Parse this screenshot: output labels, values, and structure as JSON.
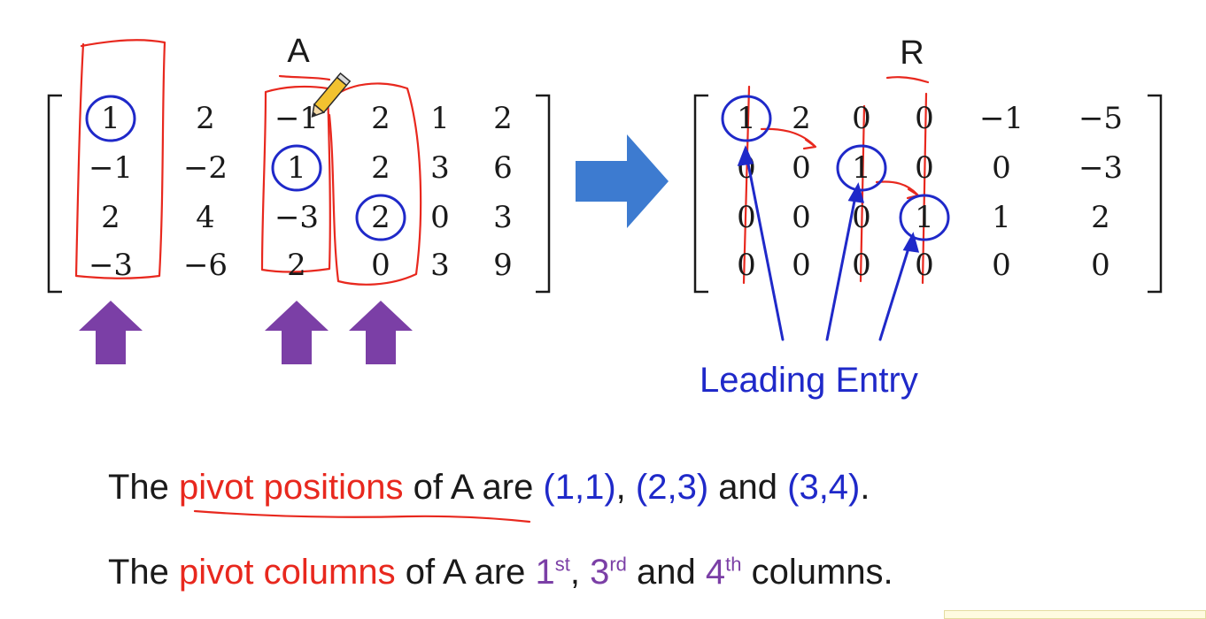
{
  "matrix_a": {
    "label": "A",
    "rows": [
      [
        "1",
        "2",
        "−1",
        "2",
        "1",
        "2"
      ],
      [
        "−1",
        "−2",
        "1",
        "2",
        "3",
        "6"
      ],
      [
        "2",
        "4",
        "−3",
        "2",
        "0",
        "3"
      ],
      [
        "−3",
        "−6",
        "2",
        "0",
        "3",
        "9"
      ]
    ],
    "circled_cells": [
      [
        0,
        0
      ],
      [
        1,
        2
      ],
      [
        2,
        3
      ]
    ],
    "pivot_columns": [
      0,
      2,
      3
    ]
  },
  "matrix_r": {
    "label": "R",
    "rows": [
      [
        "1",
        "2",
        "0",
        "0",
        "−1",
        "−5"
      ],
      [
        "0",
        "0",
        "1",
        "0",
        "0",
        "−3"
      ],
      [
        "0",
        "0",
        "0",
        "1",
        "1",
        "2"
      ],
      [
        "0",
        "0",
        "0",
        "0",
        "0",
        "0"
      ]
    ],
    "circled_cells": [
      [
        0,
        0
      ],
      [
        1,
        2
      ],
      [
        2,
        3
      ]
    ]
  },
  "annotation": {
    "label": "Leading Entry"
  },
  "sentence1": {
    "part1": "The ",
    "highlight": "pivot positions",
    "part2": " of A are ",
    "pos1": "(1,1)",
    "sep1": ", ",
    "pos2": "(2,3)",
    "sep2": " and ",
    "pos3": "(3,4)",
    "end": "."
  },
  "sentence2": {
    "part1": "The ",
    "highlight": "pivot columns",
    "part2": " of A are ",
    "col1": "1",
    "col1_sup": "st",
    "sep1": ", ",
    "col2": "3",
    "col2_sup": "rd",
    "sep2": " and ",
    "col3": "4",
    "col3_sup": "th",
    "end": " columns."
  },
  "colors": {
    "red_ink": "#e8281e",
    "blue_ink": "#1f29c9",
    "purple": "#7b3fa6",
    "arrow_blue": "#3d7bd0",
    "text": "#1a1a1a"
  },
  "icons": {
    "transform_arrow": "right-arrow-icon",
    "pivot_marker": "up-arrow-icon",
    "cursor": "pencil-icon"
  }
}
